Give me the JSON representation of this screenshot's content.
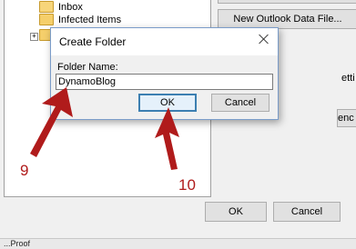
{
  "tree": {
    "items": [
      {
        "label": "Inbox"
      },
      {
        "label": "Infected Items"
      }
    ]
  },
  "right_panel": {
    "new_data_file_label": "New Outlook Data File...",
    "frag_top": "etti",
    "frag_bottom": "enc"
  },
  "dialog": {
    "title": "Create Folder",
    "folder_name_label": "Folder Name:",
    "folder_name_value": "DynamoBlog",
    "ok_label": "OK",
    "cancel_label": "Cancel"
  },
  "footer": {
    "ok_label": "OK",
    "cancel_label": "Cancel",
    "status_text": "...Proof"
  },
  "annotations": {
    "step_a": "9",
    "step_b": "10",
    "color": "#b01b1b"
  }
}
